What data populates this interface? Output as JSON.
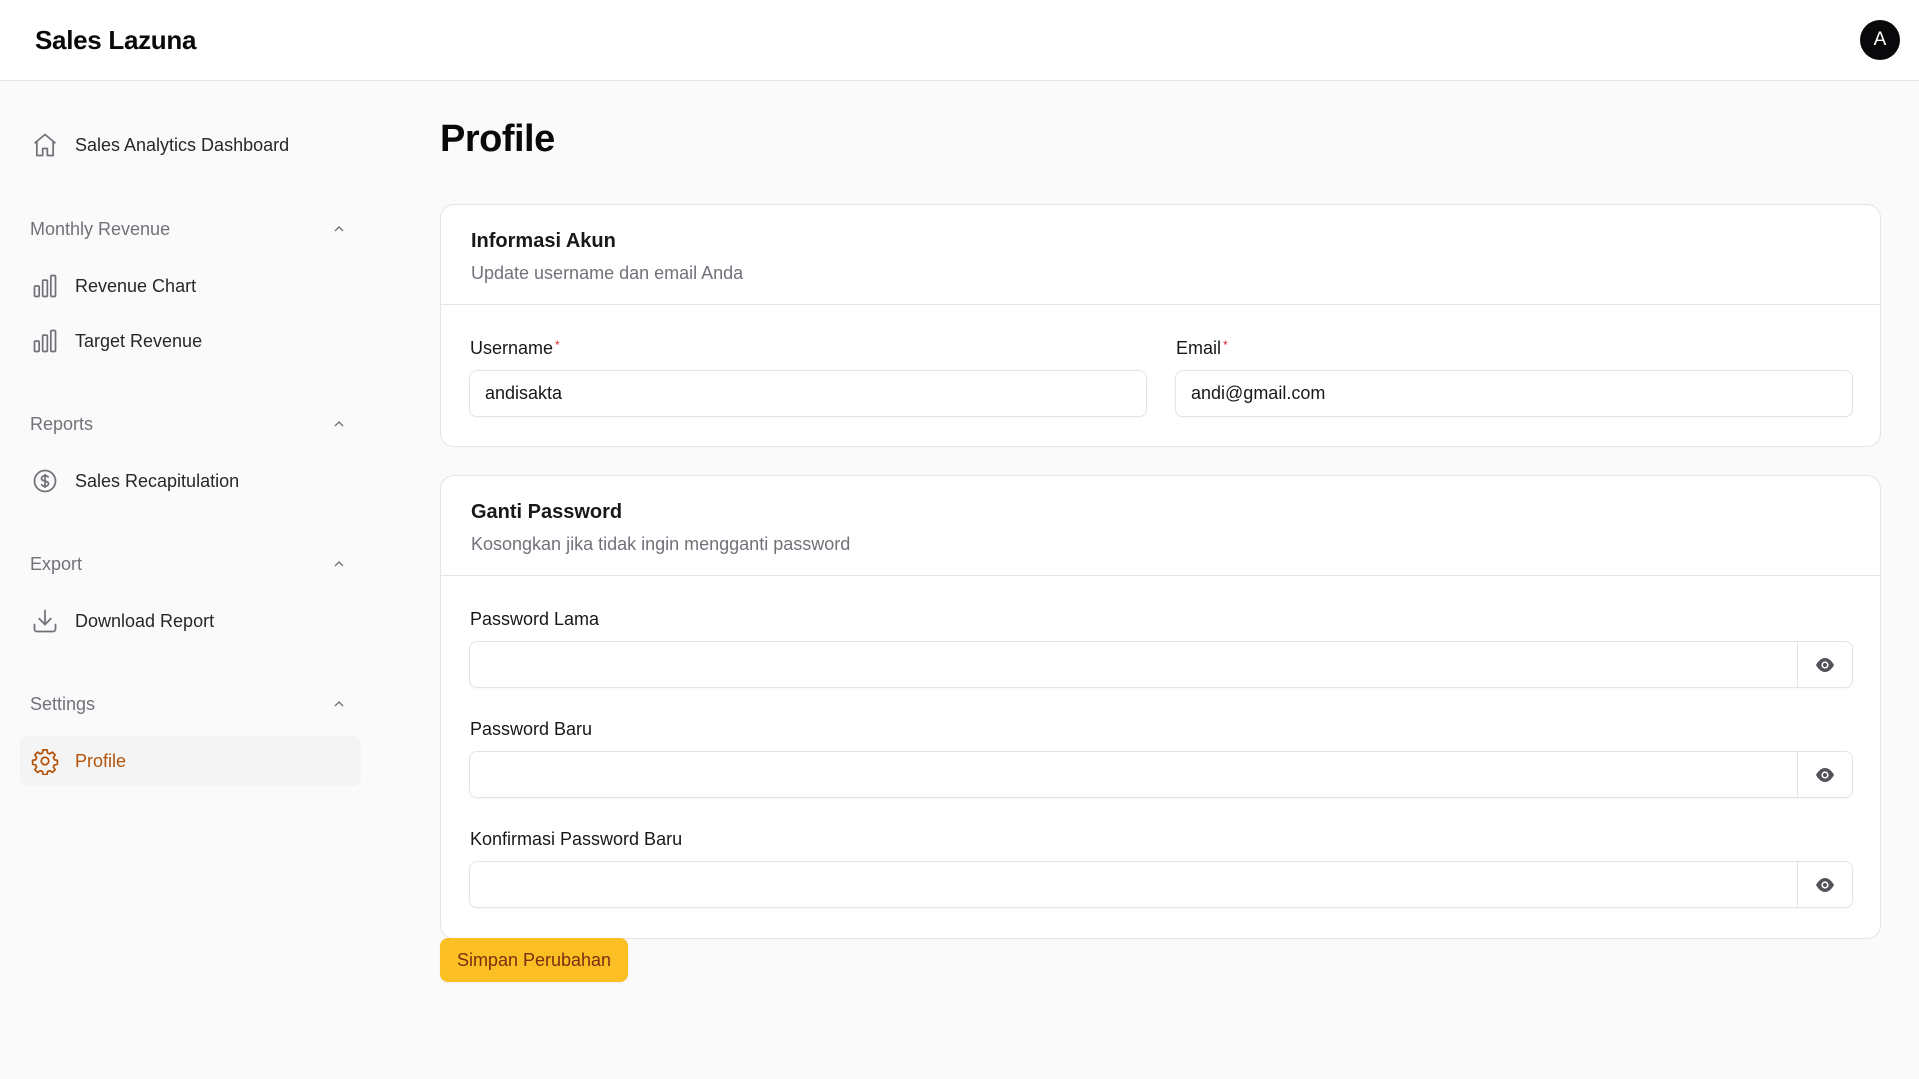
{
  "app": {
    "brand": "Sales Lazuna",
    "avatar_initial": "A"
  },
  "sidebar": {
    "dashboard": {
      "label": "Sales Analytics Dashboard",
      "icon": "home-icon"
    },
    "groups": [
      {
        "label": "Monthly Revenue",
        "items": [
          {
            "label": "Revenue Chart",
            "icon": "bar-chart-icon"
          },
          {
            "label": "Target Revenue",
            "icon": "bar-chart-icon"
          }
        ]
      },
      {
        "label": "Reports",
        "items": [
          {
            "label": "Sales Recapitulation",
            "icon": "dollar-circle-icon"
          }
        ]
      },
      {
        "label": "Export",
        "items": [
          {
            "label": "Download Report",
            "icon": "download-icon"
          }
        ]
      },
      {
        "label": "Settings",
        "items": [
          {
            "label": "Profile",
            "icon": "gear-icon",
            "active": true
          }
        ]
      }
    ]
  },
  "page": {
    "title": "Profile"
  },
  "account_card": {
    "title": "Informasi Akun",
    "description": "Update username dan email Anda",
    "username_label": "Username",
    "username_value": "andisakta",
    "email_label": "Email",
    "email_value": "andi@gmail.com",
    "required_mark": "*"
  },
  "password_card": {
    "title": "Ganti Password",
    "description": "Kosongkan jika tidak ingin mengganti password",
    "old_label": "Password Lama",
    "new_label": "Password Baru",
    "confirm_label": "Konfirmasi Password Baru"
  },
  "actions": {
    "save_label": "Simpan Perubahan"
  },
  "colors": {
    "accent": "#fbbf24",
    "active_text": "#b45309",
    "required": "#dc2626"
  }
}
